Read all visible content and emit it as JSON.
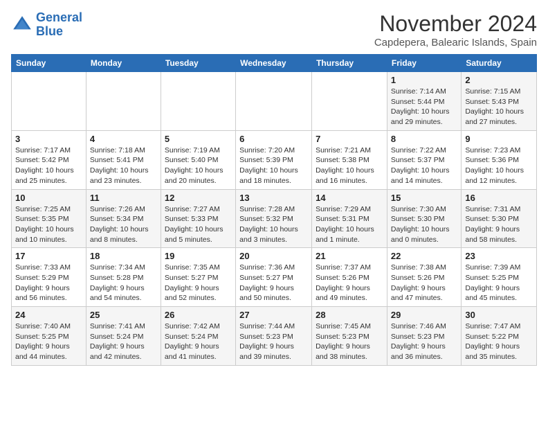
{
  "header": {
    "logo_line1": "General",
    "logo_line2": "Blue",
    "month": "November 2024",
    "location": "Capdepera, Balearic Islands, Spain"
  },
  "weekdays": [
    "Sunday",
    "Monday",
    "Tuesday",
    "Wednesday",
    "Thursday",
    "Friday",
    "Saturday"
  ],
  "weeks": [
    [
      {
        "day": "",
        "info": ""
      },
      {
        "day": "",
        "info": ""
      },
      {
        "day": "",
        "info": ""
      },
      {
        "day": "",
        "info": ""
      },
      {
        "day": "",
        "info": ""
      },
      {
        "day": "1",
        "info": "Sunrise: 7:14 AM\nSunset: 5:44 PM\nDaylight: 10 hours and 29 minutes."
      },
      {
        "day": "2",
        "info": "Sunrise: 7:15 AM\nSunset: 5:43 PM\nDaylight: 10 hours and 27 minutes."
      }
    ],
    [
      {
        "day": "3",
        "info": "Sunrise: 7:17 AM\nSunset: 5:42 PM\nDaylight: 10 hours and 25 minutes."
      },
      {
        "day": "4",
        "info": "Sunrise: 7:18 AM\nSunset: 5:41 PM\nDaylight: 10 hours and 23 minutes."
      },
      {
        "day": "5",
        "info": "Sunrise: 7:19 AM\nSunset: 5:40 PM\nDaylight: 10 hours and 20 minutes."
      },
      {
        "day": "6",
        "info": "Sunrise: 7:20 AM\nSunset: 5:39 PM\nDaylight: 10 hours and 18 minutes."
      },
      {
        "day": "7",
        "info": "Sunrise: 7:21 AM\nSunset: 5:38 PM\nDaylight: 10 hours and 16 minutes."
      },
      {
        "day": "8",
        "info": "Sunrise: 7:22 AM\nSunset: 5:37 PM\nDaylight: 10 hours and 14 minutes."
      },
      {
        "day": "9",
        "info": "Sunrise: 7:23 AM\nSunset: 5:36 PM\nDaylight: 10 hours and 12 minutes."
      }
    ],
    [
      {
        "day": "10",
        "info": "Sunrise: 7:25 AM\nSunset: 5:35 PM\nDaylight: 10 hours and 10 minutes."
      },
      {
        "day": "11",
        "info": "Sunrise: 7:26 AM\nSunset: 5:34 PM\nDaylight: 10 hours and 8 minutes."
      },
      {
        "day": "12",
        "info": "Sunrise: 7:27 AM\nSunset: 5:33 PM\nDaylight: 10 hours and 5 minutes."
      },
      {
        "day": "13",
        "info": "Sunrise: 7:28 AM\nSunset: 5:32 PM\nDaylight: 10 hours and 3 minutes."
      },
      {
        "day": "14",
        "info": "Sunrise: 7:29 AM\nSunset: 5:31 PM\nDaylight: 10 hours and 1 minute."
      },
      {
        "day": "15",
        "info": "Sunrise: 7:30 AM\nSunset: 5:30 PM\nDaylight: 10 hours and 0 minutes."
      },
      {
        "day": "16",
        "info": "Sunrise: 7:31 AM\nSunset: 5:30 PM\nDaylight: 9 hours and 58 minutes."
      }
    ],
    [
      {
        "day": "17",
        "info": "Sunrise: 7:33 AM\nSunset: 5:29 PM\nDaylight: 9 hours and 56 minutes."
      },
      {
        "day": "18",
        "info": "Sunrise: 7:34 AM\nSunset: 5:28 PM\nDaylight: 9 hours and 54 minutes."
      },
      {
        "day": "19",
        "info": "Sunrise: 7:35 AM\nSunset: 5:27 PM\nDaylight: 9 hours and 52 minutes."
      },
      {
        "day": "20",
        "info": "Sunrise: 7:36 AM\nSunset: 5:27 PM\nDaylight: 9 hours and 50 minutes."
      },
      {
        "day": "21",
        "info": "Sunrise: 7:37 AM\nSunset: 5:26 PM\nDaylight: 9 hours and 49 minutes."
      },
      {
        "day": "22",
        "info": "Sunrise: 7:38 AM\nSunset: 5:26 PM\nDaylight: 9 hours and 47 minutes."
      },
      {
        "day": "23",
        "info": "Sunrise: 7:39 AM\nSunset: 5:25 PM\nDaylight: 9 hours and 45 minutes."
      }
    ],
    [
      {
        "day": "24",
        "info": "Sunrise: 7:40 AM\nSunset: 5:25 PM\nDaylight: 9 hours and 44 minutes."
      },
      {
        "day": "25",
        "info": "Sunrise: 7:41 AM\nSunset: 5:24 PM\nDaylight: 9 hours and 42 minutes."
      },
      {
        "day": "26",
        "info": "Sunrise: 7:42 AM\nSunset: 5:24 PM\nDaylight: 9 hours and 41 minutes."
      },
      {
        "day": "27",
        "info": "Sunrise: 7:44 AM\nSunset: 5:23 PM\nDaylight: 9 hours and 39 minutes."
      },
      {
        "day": "28",
        "info": "Sunrise: 7:45 AM\nSunset: 5:23 PM\nDaylight: 9 hours and 38 minutes."
      },
      {
        "day": "29",
        "info": "Sunrise: 7:46 AM\nSunset: 5:23 PM\nDaylight: 9 hours and 36 minutes."
      },
      {
        "day": "30",
        "info": "Sunrise: 7:47 AM\nSunset: 5:22 PM\nDaylight: 9 hours and 35 minutes."
      }
    ]
  ]
}
